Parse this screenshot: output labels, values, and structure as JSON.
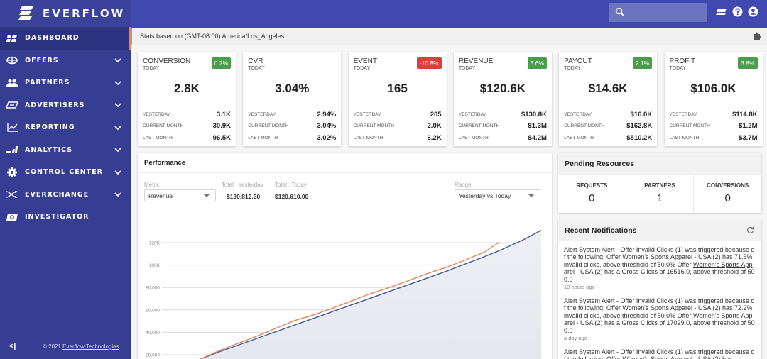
{
  "brand": {
    "name": "EVERFLOW"
  },
  "sidebar": {
    "items": [
      {
        "label": "DASHBOARD",
        "icon": "dashboard-icon",
        "active": true,
        "has_chevron": false
      },
      {
        "label": "OFFERS",
        "icon": "offers-icon",
        "active": false,
        "has_chevron": true
      },
      {
        "label": "PARTNERS",
        "icon": "partners-icon",
        "active": false,
        "has_chevron": true
      },
      {
        "label": "ADVERTISERS",
        "icon": "advertisers-icon",
        "active": false,
        "has_chevron": true
      },
      {
        "label": "REPORTING",
        "icon": "reporting-icon",
        "active": false,
        "has_chevron": true
      },
      {
        "label": "ANALYTICS",
        "icon": "analytics-icon",
        "active": false,
        "has_chevron": true
      },
      {
        "label": "CONTROL CENTER",
        "icon": "gear-icon",
        "active": false,
        "has_chevron": true
      },
      {
        "label": "EVERXCHANGE",
        "icon": "shuffle-icon",
        "active": false,
        "has_chevron": true
      },
      {
        "label": "INVESTIGATOR",
        "icon": "investigator-icon",
        "active": false,
        "has_chevron": false
      }
    ],
    "footer": {
      "collapse_label": "<|",
      "copyright_prefix": "© 2021 ",
      "company_link": "Everflow Technologies"
    }
  },
  "header": {
    "search_placeholder": "",
    "icons": [
      "messages-icon",
      "help-icon",
      "user-account-icon"
    ]
  },
  "subheader": {
    "timezone_text": "Stats based on (GMT-08:00) America/Los_Angeles"
  },
  "stats": [
    {
      "title": "CONVERSION",
      "period": "TODAY",
      "change": "0.2%",
      "trend": "up",
      "value": "2.8K",
      "rows": [
        {
          "label": "YESTERDAY",
          "value": "3.1K"
        },
        {
          "label": "CURRENT MONTH",
          "value": "30.9K"
        },
        {
          "label": "LAST MONTH",
          "value": "96.5K"
        }
      ]
    },
    {
      "title": "CVR",
      "period": "TODAY",
      "change": "",
      "trend": "none",
      "value": "3.04%",
      "rows": [
        {
          "label": "YESTERDAY",
          "value": "2.94%"
        },
        {
          "label": "CURRENT MONTH",
          "value": "3.04%"
        },
        {
          "label": "LAST MONTH",
          "value": "3.02%"
        }
      ]
    },
    {
      "title": "EVENT",
      "period": "TODAY",
      "change": "-10.8%",
      "trend": "down",
      "value": "165",
      "rows": [
        {
          "label": "YESTERDAY",
          "value": "205"
        },
        {
          "label": "CURRENT MONTH",
          "value": "2.0K"
        },
        {
          "label": "LAST MONTH",
          "value": "6.2K"
        }
      ]
    },
    {
      "title": "REVENUE",
      "period": "TODAY",
      "change": "3.6%",
      "trend": "up",
      "value": "$120.6K",
      "rows": [
        {
          "label": "YESTERDAY",
          "value": "$130.8K"
        },
        {
          "label": "CURRENT MONTH",
          "value": "$1.3M"
        },
        {
          "label": "LAST MONTH",
          "value": "$4.2M"
        }
      ]
    },
    {
      "title": "PAYOUT",
      "period": "TODAY",
      "change": "2.1%",
      "trend": "up",
      "value": "$14.6K",
      "rows": [
        {
          "label": "YESTERDAY",
          "value": "$16.0K"
        },
        {
          "label": "CURRENT MONTH",
          "value": "$162.8K"
        },
        {
          "label": "LAST MONTH",
          "value": "$510.2K"
        }
      ]
    },
    {
      "title": "PROFIT",
      "period": "TODAY",
      "change": "3.8%",
      "trend": "up",
      "value": "$106.0K",
      "rows": [
        {
          "label": "YESTERDAY",
          "value": "$114.8K"
        },
        {
          "label": "CURRENT MONTH",
          "value": "$1.2M"
        },
        {
          "label": "LAST MONTH",
          "value": "$3.7M"
        }
      ]
    }
  ],
  "performance": {
    "title": "Performance",
    "metric_label": "Metric",
    "metric_value": "Revenue",
    "total_yesterday_label": "Total : Yesterday",
    "total_yesterday_value": "$130,812.30",
    "total_today_label": "Total : Today",
    "total_today_value": "$120,610.00",
    "range_label": "Range",
    "range_value": "Yesterday vs Today"
  },
  "pending": {
    "title": "Pending Resources",
    "cells": [
      {
        "label": "REQUESTS",
        "value": "0"
      },
      {
        "label": "PARTNERS",
        "value": "1"
      },
      {
        "label": "CONVERSIONS",
        "value": "0"
      }
    ]
  },
  "notifications": {
    "title": "Recent Notifications",
    "items": [
      {
        "pre": "Alert System Alert - Offer Invalid Clicks (1) was triggered because of the following: Offer ",
        "link1": "Women's Sports Apparel - USA (2)",
        "mid": " has 71.5% invalid clicks, above threshold of 50.0% Offer ",
        "link2": "Women's Sports Apparel - USA (2)",
        "post": " has a Gross Clicks of 16516.0, above threshold of 500.0",
        "time": "10 hours ago"
      },
      {
        "pre": "Alert System Alert - Offer Invalid Clicks (1) was triggered because of the following: Offer ",
        "link1": "Women's Sports Apparel - USA (2)",
        "mid": " has 72.2% invalid clicks, above threshold of 50.0% Offer ",
        "link2": "Women's Sports Apparel - USA (2)",
        "post": " has a Gross Clicks of 17029.0, above threshold of 500.0",
        "time": "a day ago"
      },
      {
        "pre": "Alert System Alert - Offer Invalid Clicks (1) was triggered because of the following: Offer ",
        "link1": "Women's Sports Apparel - USA (2)",
        "mid": " has",
        "link2": "",
        "post": "",
        "time": ""
      }
    ]
  },
  "colors": {
    "sidebar_bg": "#363e94",
    "topbar_bg": "#4049ad",
    "accent_orange": "#e8884f",
    "badge_up": "#4a9e4a",
    "badge_down": "#d9403a",
    "series_yesterday": "#3f5a9a",
    "series_today": "#e8825a"
  },
  "chart_data": {
    "type": "area",
    "title": "",
    "xlabel": "",
    "ylabel": "",
    "ylim": [
      0,
      135000
    ],
    "yticks": [
      20000,
      40000,
      60000,
      80000,
      100000,
      120000
    ],
    "ytick_labels": [
      "20,000",
      "40,000",
      "60,000",
      "80,000",
      "100K",
      "120K"
    ],
    "grid": true,
    "legend": "none",
    "x_progress": [
      0.1,
      0.15,
      0.2,
      0.25,
      0.3,
      0.35,
      0.4,
      0.45,
      0.5,
      0.55,
      0.6,
      0.65,
      0.7,
      0.75,
      0.8,
      0.85,
      0.89,
      0.95,
      1.0
    ],
    "series": [
      {
        "name": "Yesterday",
        "style": "area",
        "values": [
          16000,
          22500,
          28500,
          34500,
          40500,
          46500,
          52500,
          58500,
          64500,
          70500,
          76500,
          82500,
          88500,
          94500,
          101000,
          107500,
          113000,
          122000,
          131000
        ]
      },
      {
        "name": "Today",
        "style": "line",
        "values": [
          16000,
          23500,
          30000,
          36500,
          43500,
          50500,
          55500,
          61500,
          68000,
          74500,
          80000,
          86000,
          92500,
          98000,
          104500,
          111500,
          120600
        ]
      }
    ]
  }
}
